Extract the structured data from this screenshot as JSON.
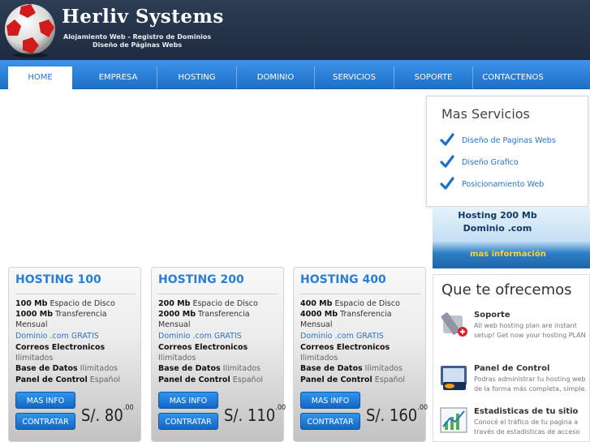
{
  "header": {
    "brand": "Herliv Systems",
    "tagline_line1": "Alojamiento Web - Registro de Dominios",
    "tagline_line2": "Diseño de Páginas Webs"
  },
  "nav": {
    "tabs": [
      {
        "label": "HOME",
        "active": true
      },
      {
        "label": "EMPRESA",
        "active": false
      },
      {
        "label": "HOSTING",
        "active": false
      },
      {
        "label": "DOMINIO",
        "active": false
      },
      {
        "label": "SERVICIOS",
        "active": false
      },
      {
        "label": "SOPORTE",
        "active": false
      },
      {
        "label": "CONTACTENOS",
        "active": false
      }
    ]
  },
  "mas_servicios": {
    "title": "Mas Servicios",
    "items": [
      "Diseño de Paginas Webs",
      "Diseño Grafico",
      "Posicionamiento Web"
    ]
  },
  "banner": {
    "line1": "Hosting 200 Mb",
    "line2": "Dominio .com",
    "more": "mas información"
  },
  "ofrecemos": {
    "title": "Que te ofrecemos",
    "items": [
      {
        "title": "Soporte",
        "text": "All web hosting plan are instant setup! Get now your hosting PLAN"
      },
      {
        "title": "Panel de Control",
        "text": "Podras administrar tu hosting web de la forma más completa, simple."
      },
      {
        "title": "Estadisticas de tu sitio",
        "text": "Conocé el tráfico de tu pagina a través de estadisticas de acceso"
      }
    ]
  },
  "plans": [
    {
      "title": "HOSTING 100",
      "disk_value": "100 Mb",
      "disk_label": "Espacio de Disco",
      "transfer_value": "1000 Mb",
      "transfer_label": "Transferencia Mensual",
      "domain": "Dominio .com GRATIS",
      "email_label": "Correos Electronicos",
      "email_value": "Ilimitados",
      "db_label": "Base de Datos",
      "db_value": "Ilimitados",
      "panel_label": "Panel de Control",
      "panel_value": "Español",
      "info_button": "MAS INFO",
      "buy_button": "CONTRATAR",
      "price_main": "S/. 80",
      "price_cents": ".00"
    },
    {
      "title": "HOSTING 200",
      "disk_value": "200 Mb",
      "disk_label": "Espacio de Disco",
      "transfer_value": "2000 Mb",
      "transfer_label": "Transferencia Mensual",
      "domain": "Dominio .com GRATIS",
      "email_label": "Correos Electronicos",
      "email_value": "Ilimitados",
      "db_label": "Base de Datos",
      "db_value": "Ilimitados",
      "panel_label": "Panel de Control",
      "panel_value": "Español",
      "info_button": "MAS INFO",
      "buy_button": "CONTRATAR",
      "price_main": "S/. 110",
      "price_cents": ".00"
    },
    {
      "title": "HOSTING 400",
      "disk_value": "400 Mb",
      "disk_label": "Espacio de Disco",
      "transfer_value": "4000 Mb",
      "transfer_label": "Transferencia Mensual",
      "domain": "Dominio .com GRATIS",
      "email_label": "Correos Electronicos",
      "email_value": "Ilimitados",
      "db_label": "Base de Datos",
      "db_value": "Ilimitados",
      "panel_label": "Panel de Control",
      "panel_value": "Español",
      "info_button": "MAS INFO",
      "buy_button": "CONTRATAR",
      "price_main": "S/. 160",
      "price_cents": ".00"
    }
  ],
  "colors": {
    "header_bg": "#1d2a3f",
    "nav_blue": "#2a7fd4",
    "link_blue": "#2a74c9",
    "button_blue": "#1f7fdc"
  }
}
